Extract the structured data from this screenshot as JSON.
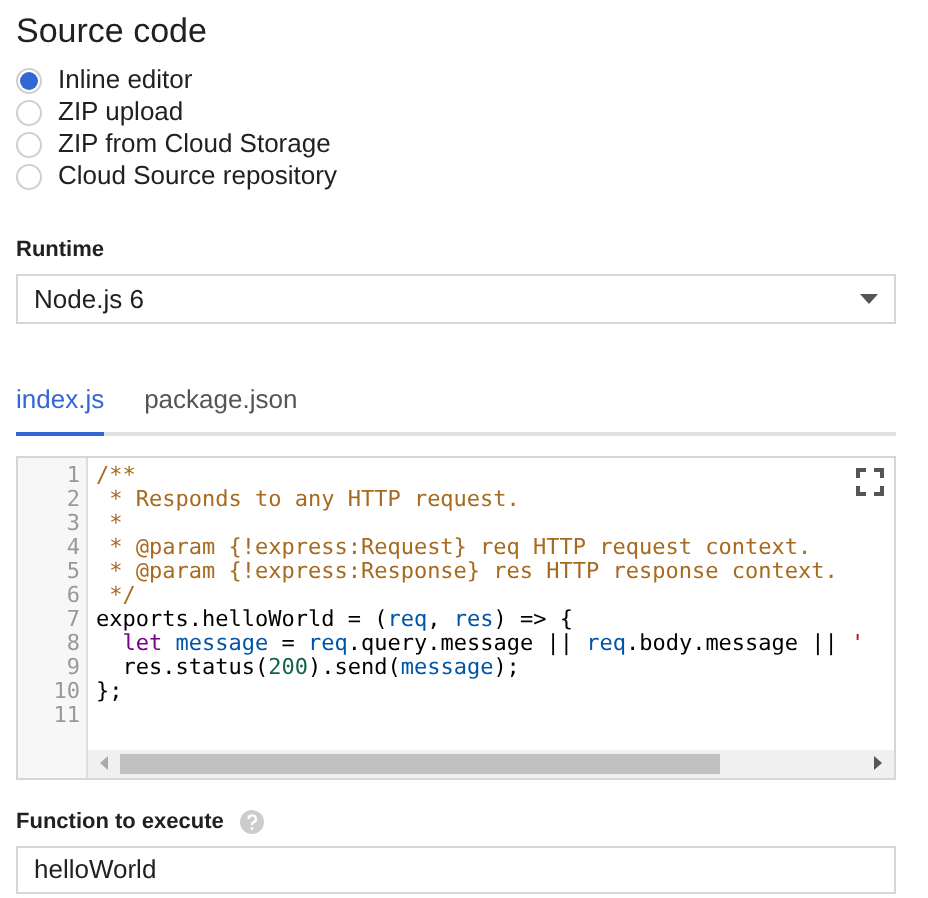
{
  "section_title": "Source code",
  "source_options": [
    {
      "label": "Inline editor",
      "selected": true
    },
    {
      "label": "ZIP upload",
      "selected": false
    },
    {
      "label": "ZIP from Cloud Storage",
      "selected": false
    },
    {
      "label": "Cloud Source repository",
      "selected": false
    }
  ],
  "runtime": {
    "label": "Runtime",
    "value": "Node.js 6"
  },
  "tabs": [
    {
      "label": "index.js",
      "selected": true
    },
    {
      "label": "package.json",
      "selected": false
    }
  ],
  "editor": {
    "lines": [
      {
        "number": "1",
        "tokens": [
          {
            "kind": "comment",
            "text": "/**"
          }
        ]
      },
      {
        "number": "2",
        "tokens": [
          {
            "kind": "comment",
            "text": " * Responds to any HTTP request."
          }
        ]
      },
      {
        "number": "3",
        "tokens": [
          {
            "kind": "comment",
            "text": " *"
          }
        ]
      },
      {
        "number": "4",
        "tokens": [
          {
            "kind": "comment",
            "text": " * @param {!express:Request} req HTTP request context."
          }
        ]
      },
      {
        "number": "5",
        "tokens": [
          {
            "kind": "comment",
            "text": " * @param {!express:Response} res HTTP response context."
          }
        ]
      },
      {
        "number": "6",
        "tokens": [
          {
            "kind": "comment",
            "text": " */"
          }
        ]
      },
      {
        "number": "7",
        "tokens": [
          {
            "kind": "plain",
            "text": "exports.helloWorld = ("
          },
          {
            "kind": "variable",
            "text": "req"
          },
          {
            "kind": "plain",
            "text": ", "
          },
          {
            "kind": "variable",
            "text": "res"
          },
          {
            "kind": "plain",
            "text": ") => {"
          }
        ]
      },
      {
        "number": "8",
        "tokens": [
          {
            "kind": "keyword",
            "text": "  let "
          },
          {
            "kind": "variable",
            "text": "message"
          },
          {
            "kind": "plain",
            "text": " = "
          },
          {
            "kind": "variable",
            "text": "req"
          },
          {
            "kind": "plain",
            "text": ".query.message || "
          },
          {
            "kind": "variable",
            "text": "req"
          },
          {
            "kind": "plain",
            "text": ".body.message || "
          },
          {
            "kind": "string",
            "text": "'"
          }
        ]
      },
      {
        "number": "9",
        "tokens": [
          {
            "kind": "plain",
            "text": "  res.status("
          },
          {
            "kind": "number",
            "text": "200"
          },
          {
            "kind": "plain",
            "text": ").send("
          },
          {
            "kind": "variable",
            "text": "message"
          },
          {
            "kind": "plain",
            "text": ");"
          }
        ]
      },
      {
        "number": "10",
        "tokens": [
          {
            "kind": "plain",
            "text": "};"
          }
        ]
      },
      {
        "number": "11"
      }
    ]
  },
  "function_to_execute": {
    "label": "Function to execute",
    "value": "helloWorld"
  }
}
